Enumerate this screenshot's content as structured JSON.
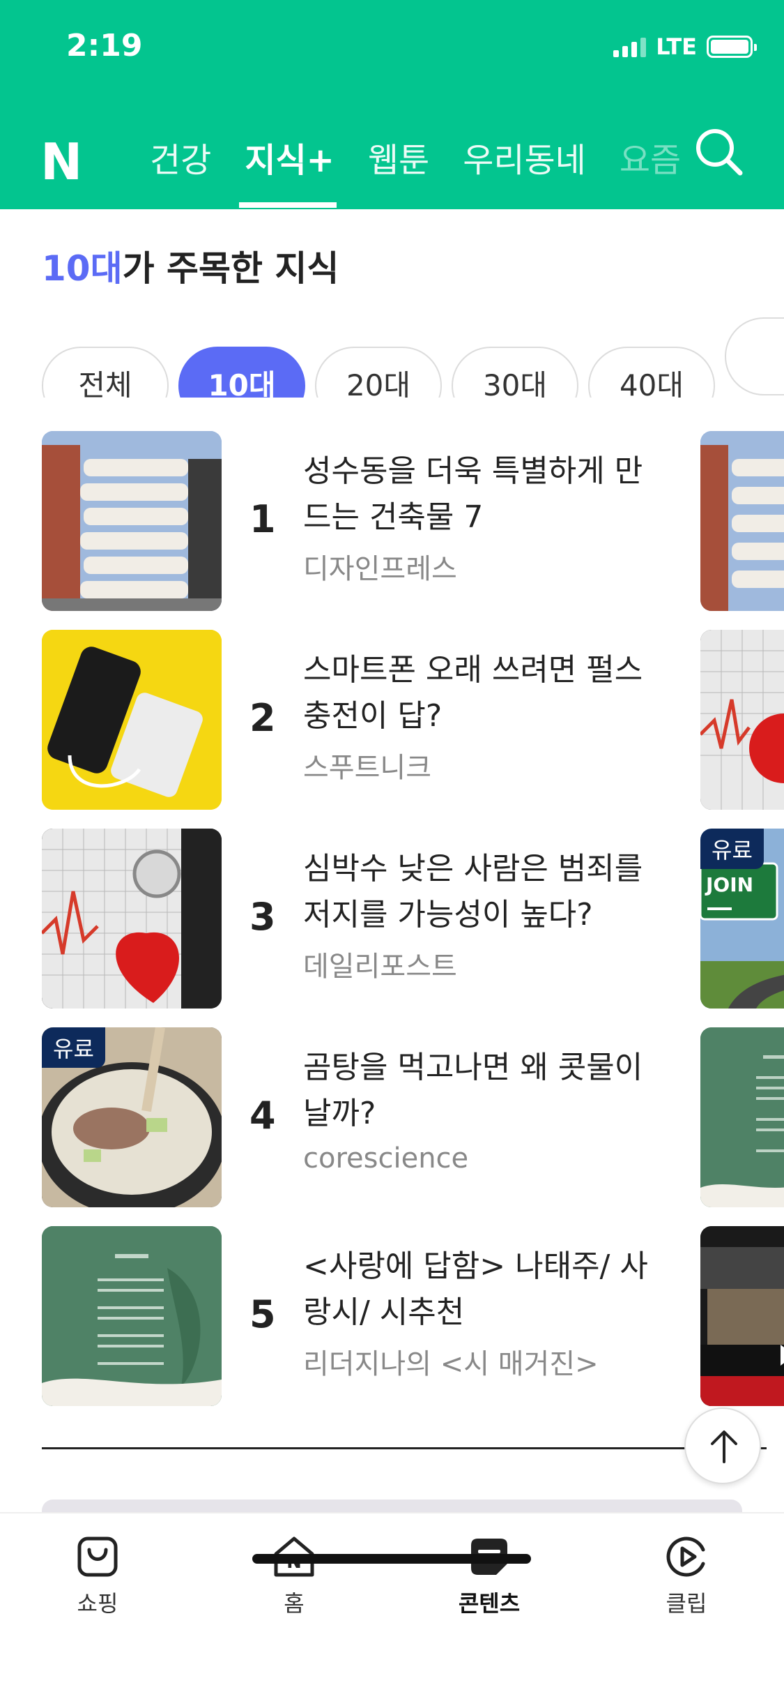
{
  "status_bar": {
    "time": "2:19",
    "network": "LTE"
  },
  "header": {
    "logo": "N",
    "tabs": [
      {
        "label": "건강"
      },
      {
        "label": "지식+"
      },
      {
        "label": "웹툰"
      },
      {
        "label": "우리동네"
      },
      {
        "label": "요즘"
      }
    ],
    "active_tab": "지식+"
  },
  "section": {
    "title_highlight": "10대",
    "title_rest": "가 주목한 지식"
  },
  "age_filters": [
    "전체",
    "10대",
    "20대",
    "30대",
    "40대"
  ],
  "active_filter": "10대",
  "ranking": [
    {
      "rank": "1",
      "title": "성수동을 더욱 특별하게 만드는 건축물 7",
      "source": "디자인프레스",
      "badge": ""
    },
    {
      "rank": "2",
      "title": "스마트폰 오래 쓰려면 펄스 충전이 답?",
      "source": "스푸트니크",
      "badge": ""
    },
    {
      "rank": "3",
      "title": "심박수 낮은 사람은 범죄를 저지를 가능성이 높다?",
      "source": "데일리포스트",
      "badge": ""
    },
    {
      "rank": "4",
      "title": "곰탕을 먹고나면 왜 콧물이 날까?",
      "source": "corescience",
      "badge": "유료"
    },
    {
      "rank": "5",
      "title": "<사랑에 답함> 나태주/ 사랑시/ 시추천",
      "source": "리더지나의 <시 매거진>",
      "badge": ""
    }
  ],
  "peek_badge": "유료",
  "bottom_nav": [
    {
      "label": "쇼핑",
      "icon": "shopping-bag-icon"
    },
    {
      "label": "홈",
      "icon": "home-icon"
    },
    {
      "label": "콘텐츠",
      "icon": "content-icon"
    },
    {
      "label": "클립",
      "icon": "clip-icon"
    }
  ],
  "colors": {
    "brand": "#03c58f",
    "accent": "#5b6bf5",
    "badge": "#0d2a5b"
  }
}
